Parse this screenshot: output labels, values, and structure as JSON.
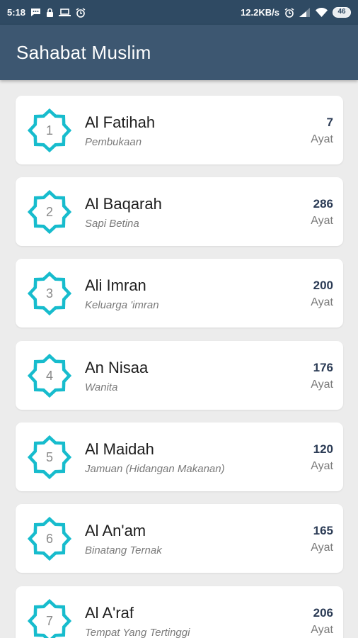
{
  "status_bar": {
    "time": "5:18",
    "speed": "12.2KB/s",
    "battery": "46",
    "left_icons": [
      "chat-icon",
      "lock-icon",
      "laptop-icon",
      "alarm-icon"
    ],
    "right_icons": [
      "alarm-icon",
      "signal-icon",
      "wifi-icon",
      "battery-icon"
    ]
  },
  "app_bar": {
    "title": "Sahabat Muslim",
    "background": "#3d5771"
  },
  "accent_color": "#17bccd",
  "surahs": [
    {
      "number": "1",
      "name": "Al Fatihah",
      "meaning": "Pembukaan",
      "ayat_count": "7",
      "ayat_label": "Ayat"
    },
    {
      "number": "2",
      "name": "Al Baqarah",
      "meaning": "Sapi Betina",
      "ayat_count": "286",
      "ayat_label": "Ayat"
    },
    {
      "number": "3",
      "name": "Ali Imran",
      "meaning": "Keluarga 'imran",
      "ayat_count": "200",
      "ayat_label": "Ayat"
    },
    {
      "number": "4",
      "name": "An Nisaa",
      "meaning": "Wanita",
      "ayat_count": "176",
      "ayat_label": "Ayat"
    },
    {
      "number": "5",
      "name": "Al Maidah",
      "meaning": "Jamuan (Hidangan Makanan)",
      "ayat_count": "120",
      "ayat_label": "Ayat"
    },
    {
      "number": "6",
      "name": "Al An'am",
      "meaning": "Binatang Ternak",
      "ayat_count": "165",
      "ayat_label": "Ayat"
    },
    {
      "number": "7",
      "name": "Al A'raf",
      "meaning": "Tempat Yang Tertinggi",
      "ayat_count": "206",
      "ayat_label": "Ayat"
    }
  ]
}
